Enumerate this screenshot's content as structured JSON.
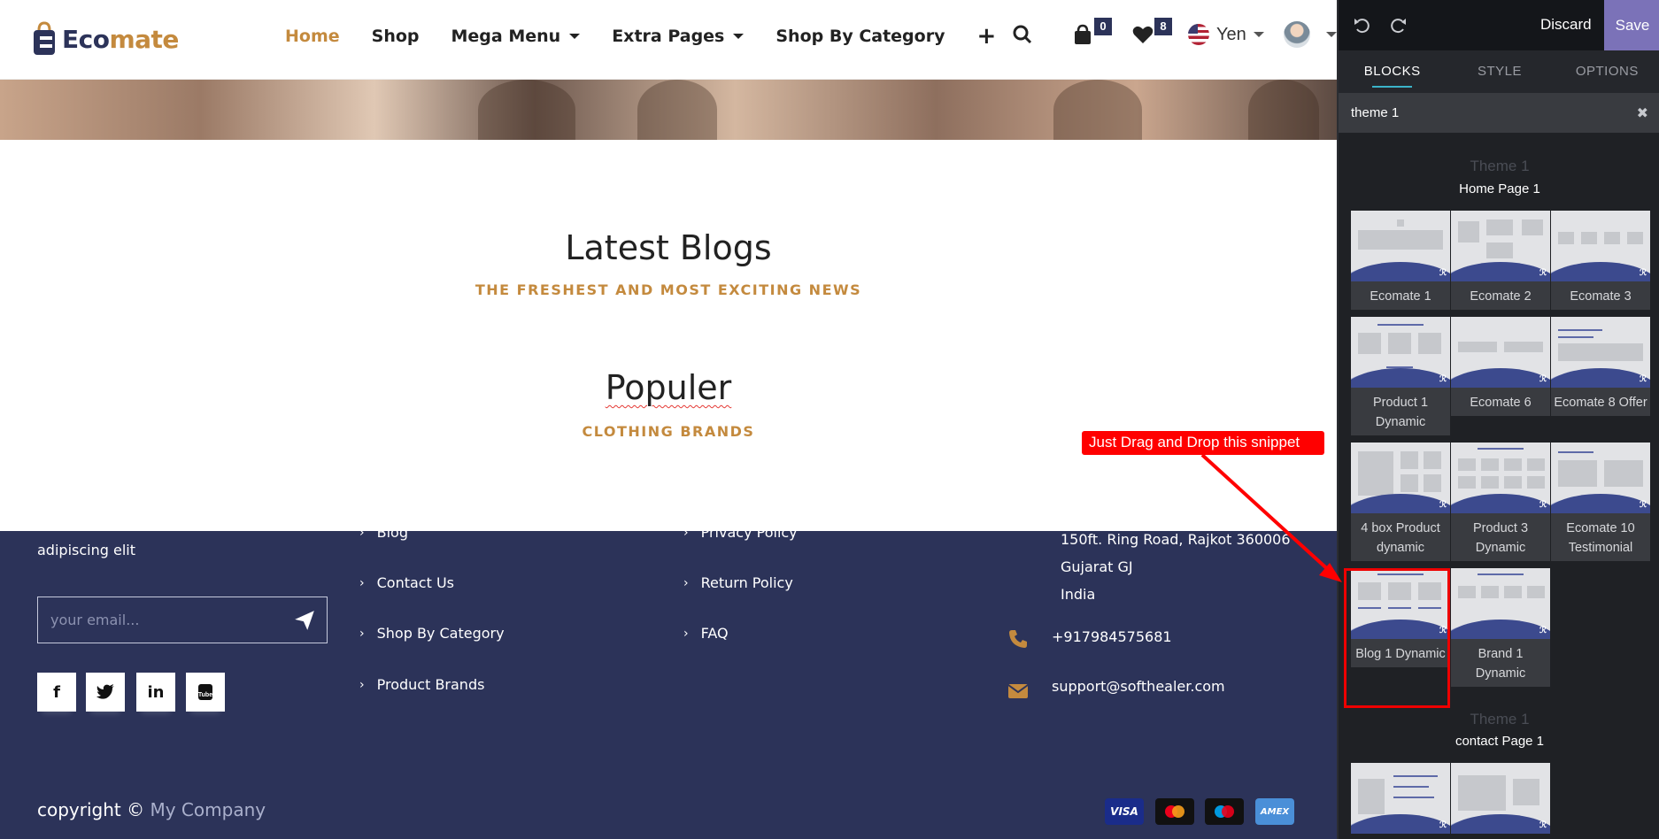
{
  "site": {
    "logo": {
      "prefix": "Eco",
      "suffix": "mate"
    },
    "nav": [
      {
        "label": "Home",
        "active": true,
        "dropdown": false
      },
      {
        "label": "Shop",
        "active": false,
        "dropdown": false
      },
      {
        "label": "Mega Menu",
        "active": false,
        "dropdown": true
      },
      {
        "label": "Extra Pages",
        "active": false,
        "dropdown": true
      },
      {
        "label": "Shop By Category",
        "active": false,
        "dropdown": false
      }
    ],
    "cart_count": "0",
    "wishlist_count": "8",
    "currency": "Yen",
    "latest_blogs": {
      "title": "Latest Blogs",
      "subtitle": "THE FRESHEST AND MOST EXCITING NEWS"
    },
    "populer": {
      "title": "Populer",
      "subtitle": "CLOTHING BRANDS"
    },
    "footer": {
      "about_tail": "adipiscing elit",
      "email_placeholder": "your email...",
      "col2_links": [
        "Blog",
        "Contact Us",
        "Shop By Category",
        "Product Brands"
      ],
      "col3_links": [
        "Privacy Policy",
        "Return Policy",
        "FAQ"
      ],
      "address": [
        "150ft. Ring Road, Rajkot 360006",
        "Gujarat GJ",
        "India"
      ],
      "phone": "+917984575681",
      "email": "support@softhealer.com",
      "copyright_prefix": "copyright ©",
      "company": "My Company",
      "payments": [
        "VISA",
        "MC",
        "Maestro",
        "AMEX"
      ]
    }
  },
  "callout": {
    "text": "Just Drag and Drop this snippet"
  },
  "editor": {
    "discard": "Discard",
    "save": "Save",
    "tabs": [
      "BLOCKS",
      "STYLE",
      "OPTIONS"
    ],
    "search_value": "theme 1",
    "group1": {
      "title": "Theme 1",
      "subtitle": "Home Page 1"
    },
    "snippets": [
      {
        "label": "Ecomate 1"
      },
      {
        "label": "Ecomate 2"
      },
      {
        "label": "Ecomate 3"
      },
      {
        "label": "Product 1 Dynamic"
      },
      {
        "label": "Ecomate 6"
      },
      {
        "label": "Ecomate 8 Offer"
      },
      {
        "label": "4 box Product dynamic"
      },
      {
        "label": "Product 3 Dynamic"
      },
      {
        "label": "Ecomate 10 Testimonial"
      },
      {
        "label": "Blog 1 Dynamic"
      },
      {
        "label": "Brand 1 Dynamic"
      }
    ],
    "group2": {
      "title": "Theme 1",
      "subtitle": "contact Page 1"
    }
  },
  "colors": {
    "brand_navy": "#2c3359",
    "brand_gold": "#c48a3e",
    "save_purple": "#7b72b8",
    "callout_red": "#ff0000"
  }
}
